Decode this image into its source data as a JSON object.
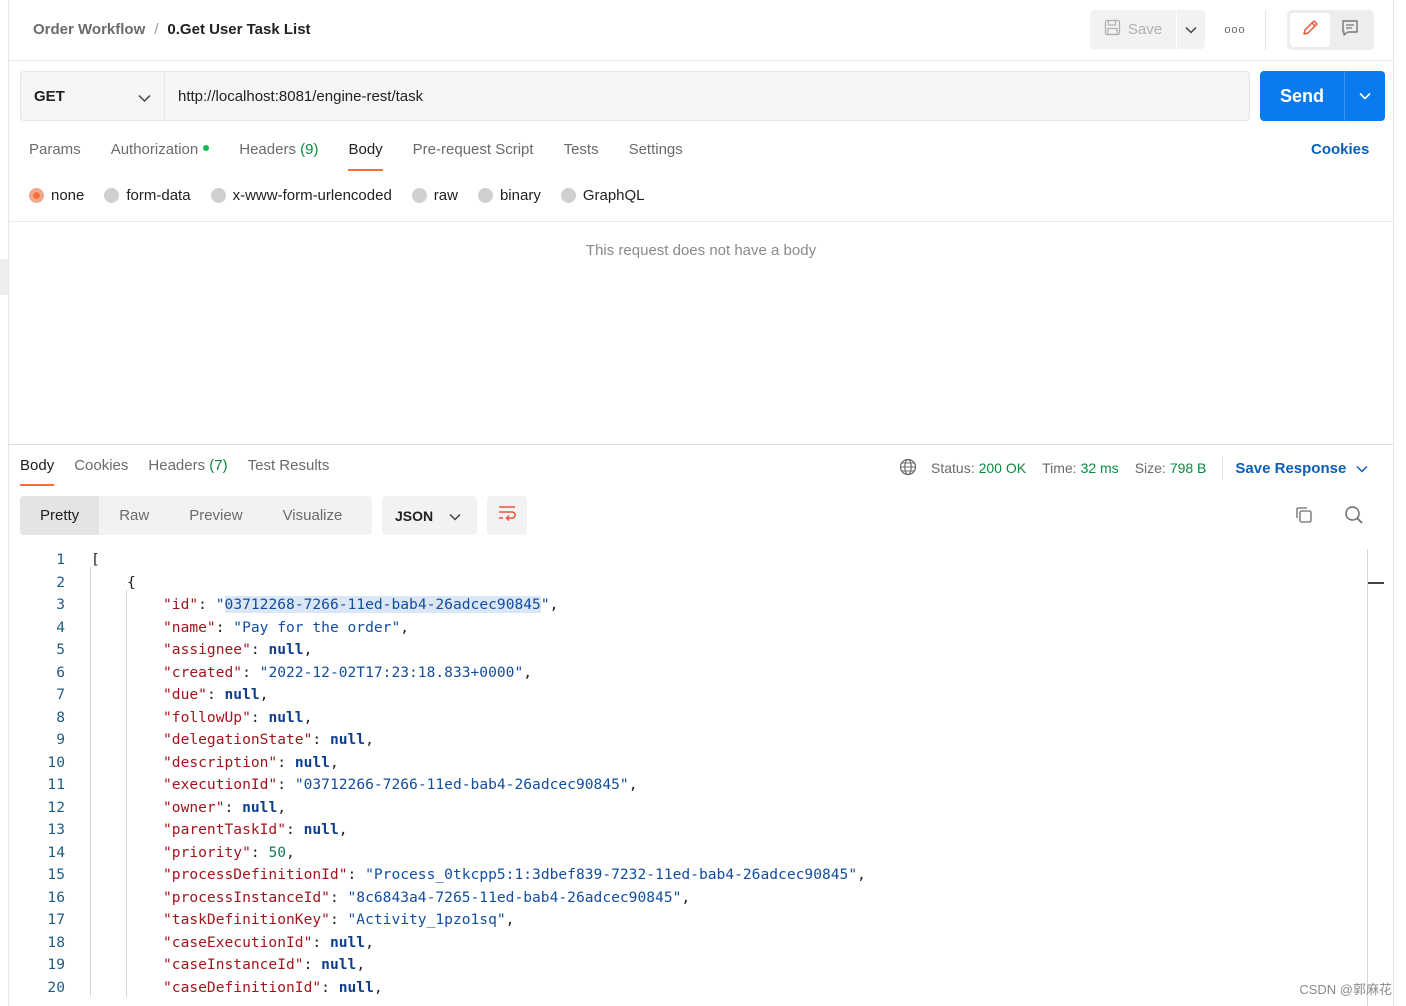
{
  "header": {
    "breadcrumb_parent": "Order Workflow",
    "breadcrumb_sep": "/",
    "breadcrumb_current": "0.Get User Task List",
    "save_label": "Save",
    "more_label": "ooo"
  },
  "request": {
    "method": "GET",
    "url": "http://localhost:8081/engine-rest/task",
    "send_label": "Send",
    "tabs": {
      "params": "Params",
      "authorization": "Authorization",
      "headers": "Headers",
      "headers_count": "(9)",
      "body": "Body",
      "prerequest": "Pre-request Script",
      "tests": "Tests",
      "settings": "Settings"
    },
    "cookies_label": "Cookies",
    "body_types": {
      "none": "none",
      "form_data": "form-data",
      "urlencoded": "x-www-form-urlencoded",
      "raw": "raw",
      "binary": "binary",
      "graphql": "GraphQL"
    },
    "no_body_text": "This request does not have a body"
  },
  "response": {
    "tabs": {
      "body": "Body",
      "cookies": "Cookies",
      "headers": "Headers",
      "headers_count": "(7)",
      "test_results": "Test Results"
    },
    "status_label": "Status:",
    "status_value": "200 OK",
    "time_label": "Time:",
    "time_value": "32 ms",
    "size_label": "Size:",
    "size_value": "798 B",
    "save_response_label": "Save Response",
    "views": {
      "pretty": "Pretty",
      "raw": "Raw",
      "preview": "Preview",
      "visualize": "Visualize"
    },
    "format": "JSON",
    "line_numbers": [
      "1",
      "2",
      "3",
      "4",
      "5",
      "6",
      "7",
      "8",
      "9",
      "10",
      "11",
      "12",
      "13",
      "14",
      "15",
      "16",
      "17",
      "18",
      "19",
      "20"
    ],
    "open_bracket": "[",
    "open_brace": "{",
    "fields": [
      {
        "key": "\"id\"",
        "value": "03712268-7266-11ed-bab4-26adcec90845",
        "type": "string"
      },
      {
        "key": "\"name\"",
        "value": "\"Pay for the order\"",
        "type": "string"
      },
      {
        "key": "\"assignee\"",
        "value": "null",
        "type": "null"
      },
      {
        "key": "\"created\"",
        "value": "\"2022-12-02T17:23:18.833+0000\"",
        "type": "string"
      },
      {
        "key": "\"due\"",
        "value": "null",
        "type": "null"
      },
      {
        "key": "\"followUp\"",
        "value": "null",
        "type": "null"
      },
      {
        "key": "\"delegationState\"",
        "value": "null",
        "type": "null"
      },
      {
        "key": "\"description\"",
        "value": "null",
        "type": "null"
      },
      {
        "key": "\"executionId\"",
        "value": "\"03712266-7266-11ed-bab4-26adcec90845\"",
        "type": "string"
      },
      {
        "key": "\"owner\"",
        "value": "null",
        "type": "null"
      },
      {
        "key": "\"parentTaskId\"",
        "value": "null",
        "type": "null"
      },
      {
        "key": "\"priority\"",
        "value": "50",
        "type": "number"
      },
      {
        "key": "\"processDefinitionId\"",
        "value": "\"Process_0tkcpp5:1:3dbef839-7232-11ed-bab4-26adcec90845\"",
        "type": "string"
      },
      {
        "key": "\"processInstanceId\"",
        "value": "\"8c6843a4-7265-11ed-bab4-26adcec90845\"",
        "type": "string"
      },
      {
        "key": "\"taskDefinitionKey\"",
        "value": "\"Activity_1pzo1sq\"",
        "type": "string"
      },
      {
        "key": "\"caseExecutionId\"",
        "value": "null",
        "type": "null"
      },
      {
        "key": "\"caseInstanceId\"",
        "value": "null",
        "type": "null"
      },
      {
        "key": "\"caseDefinitionId\"",
        "value": "null",
        "type": "null"
      }
    ]
  },
  "watermark": "CSDN @郭麻花",
  "colors": {
    "accent": "#ff6c37",
    "send": "#097bed",
    "link": "#0b5fb8",
    "status_ok": "#0a8a3e"
  }
}
